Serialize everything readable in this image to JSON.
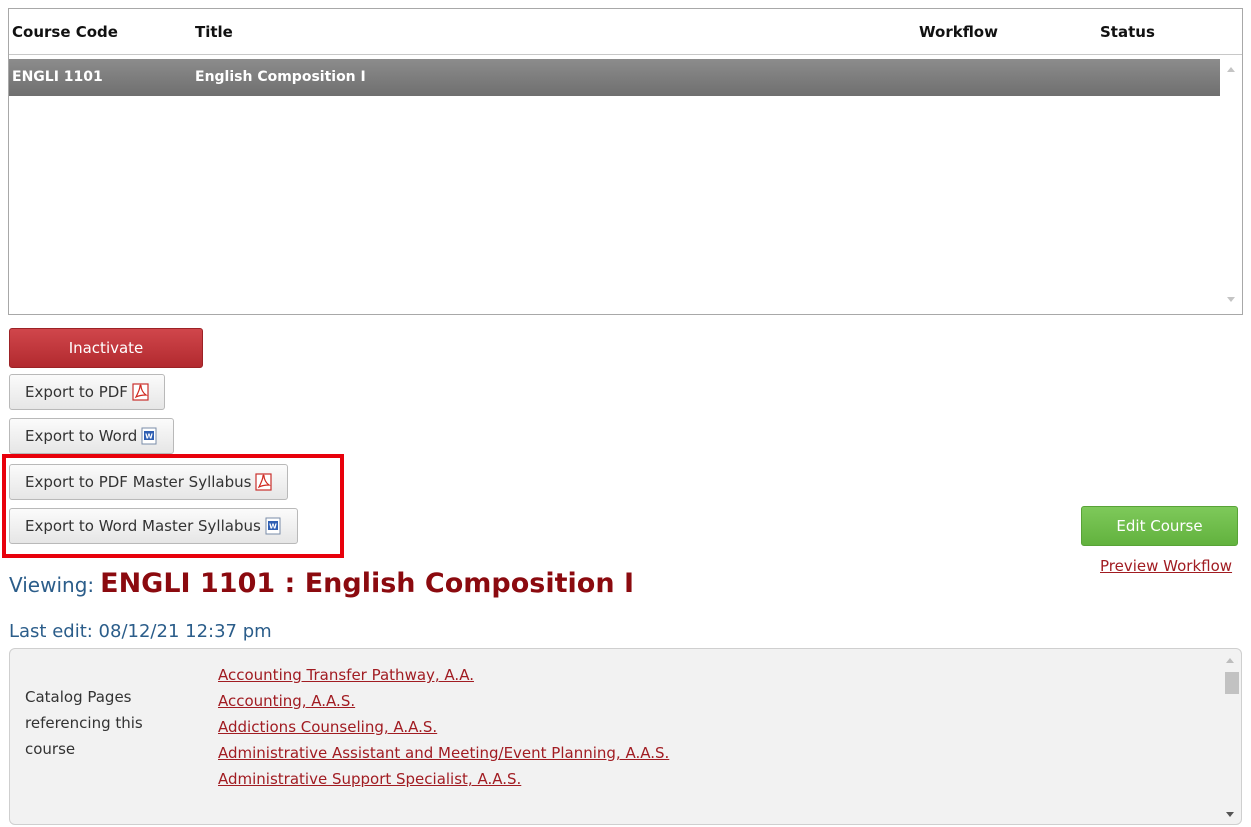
{
  "grid": {
    "columns": [
      "Course Code",
      "Title",
      "Workflow",
      "Status"
    ],
    "rows": [
      {
        "code": "ENGLI 1101",
        "title": "English Composition I",
        "workflow": "",
        "status": ""
      }
    ]
  },
  "actions": {
    "inactivate": "Inactivate",
    "export_pdf": "Export to PDF",
    "export_word": "Export to Word",
    "export_pdf_master": "Export to PDF Master Syllabus",
    "export_word_master": "Export to Word Master Syllabus",
    "edit_course": "Edit Course",
    "preview_workflow": "Preview Workflow"
  },
  "viewing": {
    "prefix": "Viewing:",
    "course": "ENGLI 1101 : English Composition I"
  },
  "last_edit": "Last edit: 08/12/21 12:37 pm",
  "catalog": {
    "label": "Catalog Pages referencing this course",
    "items": [
      "Accounting Transfer Pathway, A.A.",
      "Accounting, A.A.S.",
      "Addictions Counseling, A.A.S.",
      "Administrative Assistant and Meeting/Event Planning, A.A.S.",
      "Administrative Support Specialist, A.A.S."
    ]
  },
  "colors": {
    "danger": "#b22a2f",
    "success": "#62b23e",
    "link": "#a11c22",
    "heading_blue": "#2b5d8a",
    "highlight": "#e8000b"
  }
}
